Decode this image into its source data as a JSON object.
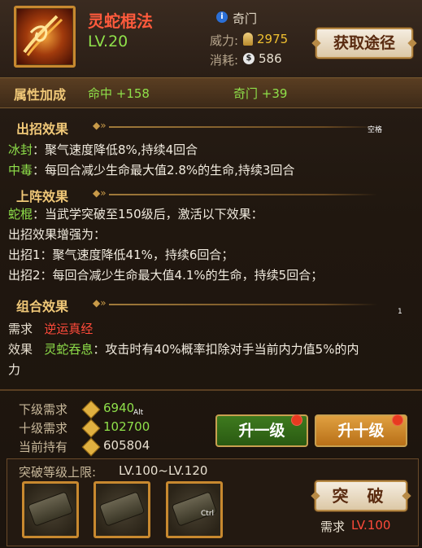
{
  "skill": {
    "name": "灵蛇棍法",
    "level": "LV.20",
    "category_icon": "info-icon",
    "category": "奇门",
    "power_label": "威力:",
    "power_value": "2975",
    "cost_label": "消耗:",
    "cost_value": "586",
    "get_button": "获取途径"
  },
  "attributes": {
    "title": "属性加成",
    "items": [
      "命中 +158",
      "奇门 +39"
    ]
  },
  "attack_effect": {
    "title": "出招效果",
    "tag": "空格",
    "lines": [
      {
        "key": "冰封",
        "text": "：聚气速度降低8%,持续4回合"
      },
      {
        "key": "中毒",
        "text": "：每回合减少生命最大值2.8%的生命,持续3回合"
      }
    ]
  },
  "formation_effect": {
    "title": "上阵效果",
    "key": "蛇棍",
    "text": "：当武学突破至150级后，激活以下效果：",
    "lines": [
      "出招效果增强为：",
      "出招1：聚气速度降低41%，持续6回合；",
      "出招2：每回合减少生命最大值4.1%的生命，持续5回合；"
    ]
  },
  "combo_effect": {
    "title": "组合效果",
    "badge": "1",
    "require_label": "需求",
    "require_value": "逆运真经",
    "effect_label": "效果",
    "effect_key": "灵蛇吞息",
    "effect_text": "：攻击时有40%概率扣除对手当前内力值5%的内",
    "effect_text_2": "力"
  },
  "resources": {
    "next_label": "下级需求",
    "next_value": "6940",
    "next_tag": "Alt",
    "ten_label": "十级需求",
    "ten_value": "102700",
    "hold_label": "当前持有",
    "hold_value": "605804",
    "up1_button": "升一级",
    "up10_button": "升十级"
  },
  "breakthrough": {
    "label": "突破等级上限:",
    "range": "LV.100~LV.120",
    "slot_tag": "Ctrl",
    "button": "突 破",
    "need_label": "需求",
    "need_value": "LV.100"
  },
  "colors": {
    "green": "#8fe04a",
    "red": "#ff4a3a",
    "gold": "#f0c878"
  }
}
